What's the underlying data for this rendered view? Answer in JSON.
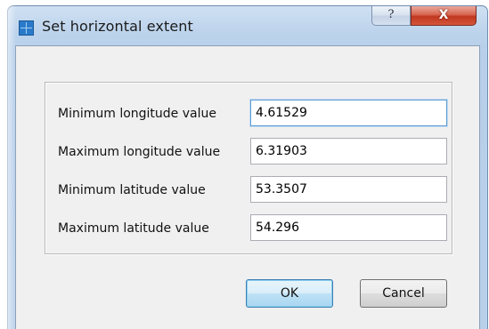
{
  "window": {
    "title": "Set horizontal extent",
    "help_label": "?",
    "close_label": "X"
  },
  "fields": [
    {
      "label": "Minimum longitude value",
      "value": "4.61529"
    },
    {
      "label": "Maximum longitude value",
      "value": "6.31903"
    },
    {
      "label": "Minimum latitude value",
      "value": "53.3507"
    },
    {
      "label": "Maximum latitude value",
      "value": "54.296"
    }
  ],
  "buttons": {
    "ok_label": "OK",
    "cancel_label": "Cancel"
  },
  "icons": {
    "app": "app-icon",
    "help": "help-icon",
    "close": "close-icon"
  },
  "colors": {
    "frame": "#b9d0ea",
    "close_button": "#c0371f",
    "focus": "#5b9bd5"
  }
}
